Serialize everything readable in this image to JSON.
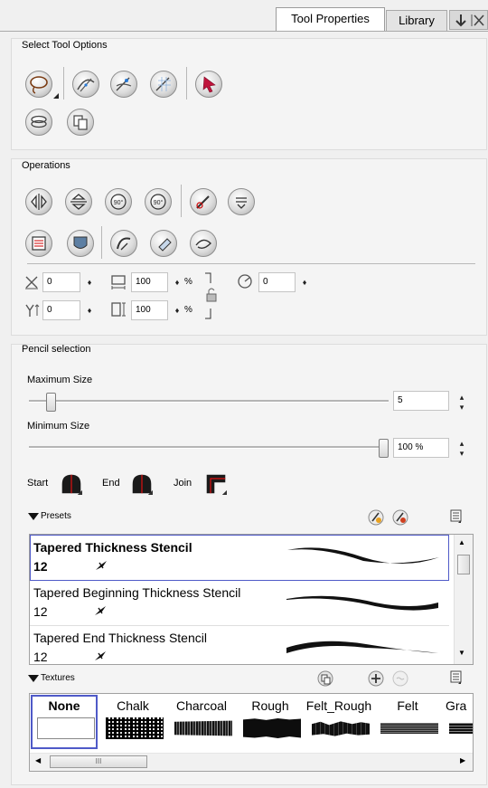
{
  "tabs": [
    {
      "label": "Tool Properties",
      "active": true
    },
    {
      "label": "Library",
      "active": false
    }
  ],
  "tab_icons": [
    "pin-icon",
    "close-icon"
  ],
  "select_tool_options": {
    "title": "Select Tool Options",
    "buttons": [
      "lasso-select",
      "snap-contour",
      "snap-point",
      "snap-grid",
      "select-by-color",
      "flatten-selection",
      "create-drawing-from-selection"
    ]
  },
  "operations": {
    "title": "Operations",
    "buttons": [
      "flip-horizontal",
      "flip-vertical",
      "rotate-90-cw",
      "rotate-90-ccw",
      "smooth",
      "flatten",
      "distribute-to-layers",
      "convert-to-pencil",
      "adjust-thickness",
      "merge-pencil",
      "convert-brush"
    ],
    "x_value": "0",
    "y_value": "0",
    "width_value": "100",
    "height_value": "100",
    "percent": "%",
    "angle_value": "0",
    "spin_symbol": "♦"
  },
  "pencil_selection": {
    "title": "Pencil selection",
    "max_size_label": "Maximum Size",
    "max_size_value": "5",
    "max_size_fraction": 0.05,
    "min_size_label": "Minimum Size",
    "min_size_value": "100 %",
    "min_size_fraction": 1.0,
    "start_label": "Start",
    "end_label": "End",
    "join_label": "Join",
    "cap_color": "#1a1a1a",
    "accent_red": "#e01010"
  },
  "presets": {
    "title": "Presets",
    "items": [
      {
        "name": "Tapered Thickness Stencil",
        "size": "12",
        "selected": true
      },
      {
        "name": "Tapered Beginning Thickness Stencil",
        "size": "12",
        "selected": false
      },
      {
        "name": "Tapered End Thickness Stencil",
        "size": "12",
        "selected": false
      }
    ]
  },
  "textures": {
    "title": "Textures",
    "items": [
      {
        "name": "None",
        "selected": true
      },
      {
        "name": "Chalk",
        "selected": false
      },
      {
        "name": "Charcoal",
        "selected": false
      },
      {
        "name": "Rough",
        "selected": false
      },
      {
        "name": "Felt_Rough",
        "selected": false
      },
      {
        "name": "Felt",
        "selected": false
      },
      {
        "name": "Gra",
        "selected": false
      }
    ],
    "scroll_grip": "III"
  }
}
